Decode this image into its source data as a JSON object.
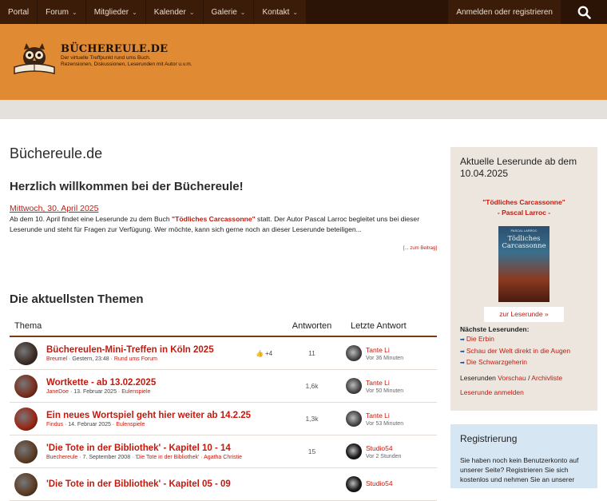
{
  "nav": {
    "items": [
      {
        "label": "Portal",
        "has_menu": false
      },
      {
        "label": "Forum",
        "has_menu": true
      },
      {
        "label": "Mitglieder",
        "has_menu": true
      },
      {
        "label": "Kalender",
        "has_menu": true
      },
      {
        "label": "Galerie",
        "has_menu": true
      },
      {
        "label": "Kontakt",
        "has_menu": true
      }
    ],
    "login_label": "Anmelden oder registrieren",
    "search_icon": "search-icon"
  },
  "header": {
    "logo_title": "BÜCHEREULE.DE",
    "logo_sub1": "Der virtuelle Treffpunkt rund ums Buch.",
    "logo_sub2": "Rezensionen, Diskussionen, Leserunden mit Autor u.v.m."
  },
  "main": {
    "page_title": "Büchereule.de",
    "welcome": "Herzlich willkommen bei der Büchereule!",
    "post_date": "Mittwoch, 30. April 2025",
    "post_text_1": "Ab dem 10. April findet eine Leserunde zu dem Buch ",
    "post_book": "\"Tödliches Carcassonne\"",
    "post_text_2": " statt. Der Autor Pascal Larroc begleitet uns bei dieser Leserunde und steht für Fragen zur Verfügung. Wer möchte, kann sich gerne noch an dieser Leserunde beteiligen...",
    "more_link": "[... zum Beitrag]",
    "topics_title": "Die aktuellsten Themen",
    "columns": {
      "topic": "Thema",
      "answers": "Antworten",
      "last": "Letzte Antwort"
    }
  },
  "topics": [
    {
      "title": "Büchereulen-Mini-Treffen in Köln 2025",
      "user": "Breumel",
      "date": "Gestern, 23:48",
      "forum": "Rund ums Forum",
      "likes": "+4",
      "answers": "11",
      "last_user": "Tante Li",
      "last_when": "Vor 36 Minuten",
      "avatar_color": "#3a2a22",
      "last_avatar_color": "#4a4a4a"
    },
    {
      "title": "Wortkette - ab 13.02.2025",
      "user": "JaneDoe",
      "date": "13. Februar 2025",
      "forum": "Eulenspiele",
      "likes": "",
      "answers": "1,6k",
      "last_user": "Tante Li",
      "last_when": "Vor 50 Minuten",
      "avatar_color": "#7a2a1a",
      "last_avatar_color": "#4a4a4a"
    },
    {
      "title": "Ein neues Wortspiel geht hier weiter ab 14.2.25",
      "user": "Findus",
      "date": "14. Februar 2025",
      "forum": "Eulenspiele",
      "likes": "",
      "answers": "1,3k",
      "last_user": "Tante Li",
      "last_when": "Vor 53 Minuten",
      "avatar_color": "#9a2412",
      "last_avatar_color": "#4a4a4a"
    },
    {
      "title": "'Die Tote in der Bibliothek' - Kapitel 10 - 14",
      "user": "Buechereule",
      "date": "7. September 2008",
      "forum": "'Die Tote in der Bibliothek' · Agatha Christie",
      "likes": "",
      "answers": "15",
      "last_user": "Studio54",
      "last_when": "Vor 2 Stunden",
      "avatar_color": "#5a3a22",
      "last_avatar_color": "#1a1a1a"
    },
    {
      "title": "'Die Tote in der Bibliothek' - Kapitel 05 - 09",
      "user": "",
      "date": "",
      "forum": "",
      "likes": "",
      "answers": "",
      "last_user": "Studio54",
      "last_when": "",
      "avatar_color": "#5a3a22",
      "last_avatar_color": "#1a1a1a"
    }
  ],
  "sidebar": {
    "leserunde_title": "Aktuelle Leserunde ab dem 10.04.2025",
    "book_title": "\"Tödliches Carcassonne\"",
    "book_author": "- Pascal Larroc -",
    "cover_author": "PASCAL LARROC",
    "cover_title": "Tödliches Carcassonne",
    "button_label": "zur Leserunde »",
    "next_title": "Nächste Leserunden:",
    "next_items": [
      "Die Erbin",
      "Schau der Welt direkt in die Augen",
      "Die Schwarzgeherin"
    ],
    "lr_prefix": "Leserunden ",
    "lr_preview": "Vorschau",
    "lr_sep": " / ",
    "lr_archive": "Archivliste",
    "lr_join": "Leserunde anmelden",
    "reg_title": "Registrierung",
    "reg_text": "Sie haben noch kein Benutzerkonto auf unserer Seite? Registrieren Sie sich kostenlos und nehmen Sie an unserer"
  },
  "colors": {
    "nav_bg": "#2b1406",
    "header_bg": "#e08a34",
    "accent": "#c41a0e",
    "side_bg": "#ece6df",
    "reg_bg": "#d6e6f3"
  }
}
